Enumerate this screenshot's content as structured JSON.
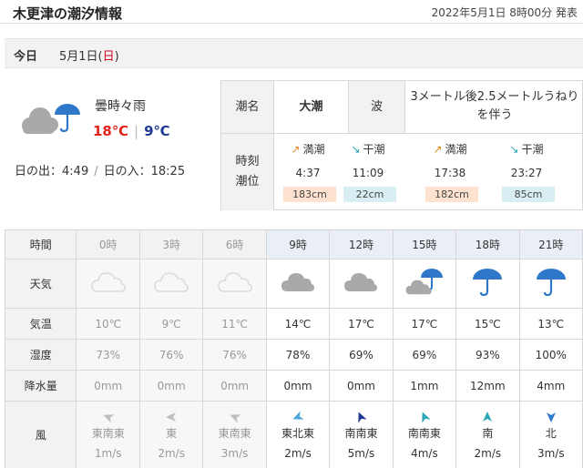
{
  "header": {
    "title": "木更津の潮汐情報",
    "issued": "2022年5月1日 8時00分 発表"
  },
  "day": {
    "today_label": "今日",
    "date_prefix": "5月1日(",
    "weekday": "日",
    "date_suffix": ")"
  },
  "summary": {
    "icon": "cloud-umbrella-icon",
    "condition": "曇時々雨",
    "temp_max": "18℃",
    "temp_sep": "|",
    "temp_min": "9℃",
    "sunrise_label": "日の出：",
    "sunrise": "4:49",
    "sep": "/",
    "sunset_label": "日の入：",
    "sunset": "18:25"
  },
  "tide": {
    "name_label": "潮名",
    "name_value": "大潮",
    "wave_label": "波",
    "wave_value": "3メートル後2.5メートルうねりを伴う",
    "time_label_1": "時刻",
    "time_label_2": "潮位",
    "events": [
      {
        "arrow": "↗",
        "kind": "満潮",
        "time": "4:37",
        "level": "183cm",
        "type": "high"
      },
      {
        "arrow": "↘",
        "kind": "干潮",
        "time": "11:09",
        "level": "22cm",
        "type": "low"
      },
      {
        "arrow": "↗",
        "kind": "満潮",
        "time": "17:38",
        "level": "182cm",
        "type": "high"
      },
      {
        "arrow": "↘",
        "kind": "干潮",
        "time": "23:27",
        "level": "85cm",
        "type": "low"
      }
    ],
    "colors": {
      "high_bg": "#fde3cf",
      "low_bg": "#d9eef2",
      "high_arrow": "#e0861c",
      "low_arrow": "#2aa7b6"
    }
  },
  "forecast": {
    "labels": {
      "time": "時間",
      "weather": "天気",
      "temp": "気温",
      "humidity": "湿度",
      "precip": "降水量",
      "wind": "風"
    },
    "hours": [
      "0時",
      "3時",
      "6時",
      "9時",
      "12時",
      "15時",
      "18時",
      "21時"
    ],
    "past_count": 3,
    "weather_icons": [
      "cloud-icon",
      "cloud-icon",
      "cloud-icon",
      "cloud-icon",
      "cloud-icon",
      "cloud-umbrella-icon",
      "umbrella-icon",
      "umbrella-icon"
    ],
    "temps": [
      "10℃",
      "9℃",
      "11℃",
      "14℃",
      "17℃",
      "17℃",
      "15℃",
      "13℃"
    ],
    "humidity": [
      "73%",
      "76%",
      "76%",
      "78%",
      "69%",
      "69%",
      "93%",
      "100%"
    ],
    "precip": [
      "0mm",
      "0mm",
      "0mm",
      "0mm",
      "0mm",
      "1mm",
      "12mm",
      "4mm"
    ],
    "wind_dir": [
      "東南東",
      "東",
      "東南東",
      "東北東",
      "南南東",
      "南南東",
      "南",
      "北"
    ],
    "wind_speed": [
      "1m/s",
      "2m/s",
      "3m/s",
      "2m/s",
      "5m/s",
      "4m/s",
      "2m/s",
      "3m/s"
    ],
    "wind_arrow_colors": [
      "#bdbdbd",
      "#bdbdbd",
      "#bdbdbd",
      "#4aa8d8",
      "#1f3a93",
      "#2aa7b6",
      "#2aa7b6",
      "#2e77c9"
    ],
    "colors": {
      "cloud_past": "#dcdcdc",
      "cloud_now": "#a9a9a9",
      "umbrella": "#2e77c9"
    }
  }
}
